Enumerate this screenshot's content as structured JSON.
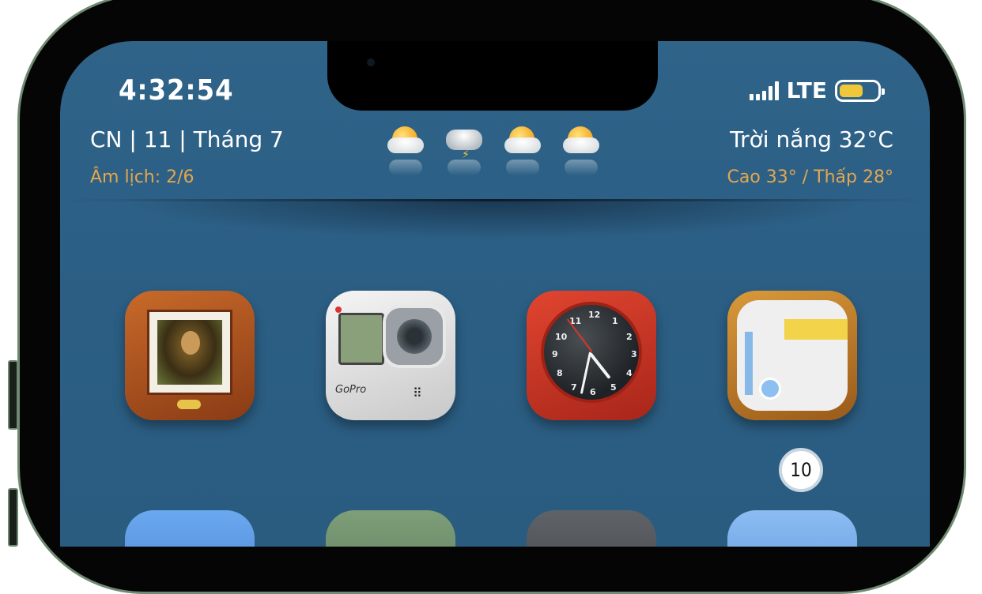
{
  "status_bar": {
    "time": "4:32:54",
    "network": "LTE",
    "battery_level": 0.62,
    "signal_icon": "signal-bars-icon",
    "battery_icon": "battery-icon"
  },
  "widget": {
    "date": "CN | 11 | Tháng 7",
    "lunar": "Âm lịch: 2/6",
    "condition": "Trời nắng 32°C",
    "range": "Cao 33° / Thấp 28°",
    "forecast_icons": [
      "partly-sunny-icon",
      "thunderstorm-icon",
      "partly-sunny-icon",
      "partly-sunny-icon"
    ]
  },
  "apps": [
    {
      "name": "photos-app-icon",
      "icon": "framed-painting-icon"
    },
    {
      "name": "camera-app-icon",
      "icon": "gopro-camera-icon",
      "text": "GoPro"
    },
    {
      "name": "clock-app-icon",
      "icon": "analog-clock-icon"
    },
    {
      "name": "maps-app-icon",
      "icon": "map-icon"
    }
  ],
  "badge": {
    "count": "10"
  },
  "colors": {
    "wallpaper": "#2c5f85",
    "accent_orange": "#e4a64e",
    "battery_fill": "#f0c63a",
    "frame": "#6f8a72"
  }
}
